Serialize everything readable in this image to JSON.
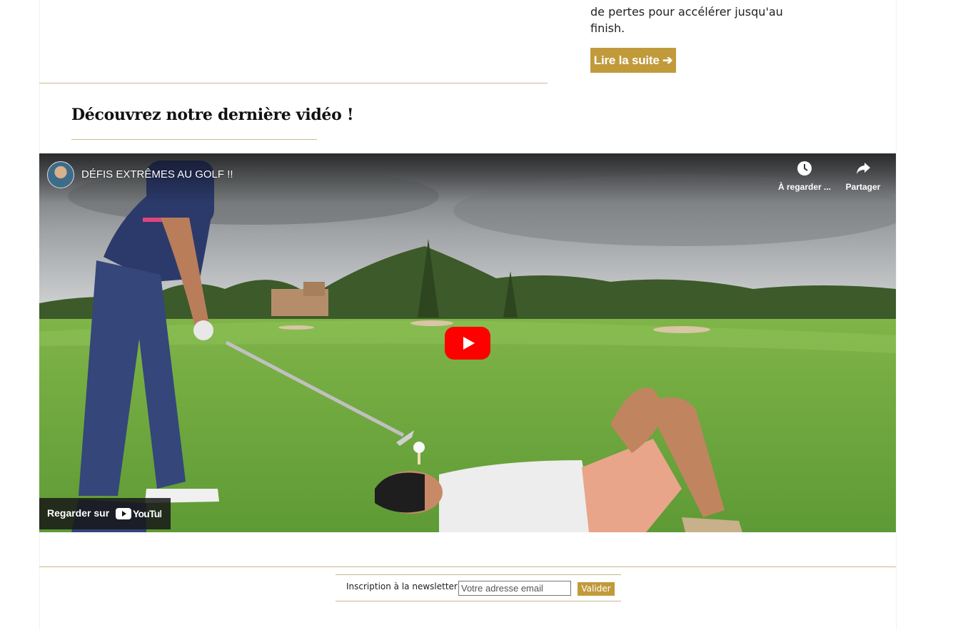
{
  "article": {
    "snippet": "de pertes pour accélérer jusqu'au finish.",
    "read_more_label": "Lire la suite ➔"
  },
  "video_section": {
    "title": "Découvrez notre dernière vidéo !"
  },
  "video": {
    "title": "DÉFIS EXTRÊMES AU GOLF !!",
    "watch_later_label": "À regarder ...",
    "share_label": "Partager",
    "watch_on_label": "Regarder sur",
    "platform_label": "YouTube",
    "play_button_color": "#ff0000"
  },
  "newsletter": {
    "label": "Inscription à la newsletter",
    "email_placeholder": "Votre adresse email",
    "submit_label": "Valider"
  },
  "colors": {
    "accent": "#c19a3b",
    "divider": "#c8b98a"
  }
}
